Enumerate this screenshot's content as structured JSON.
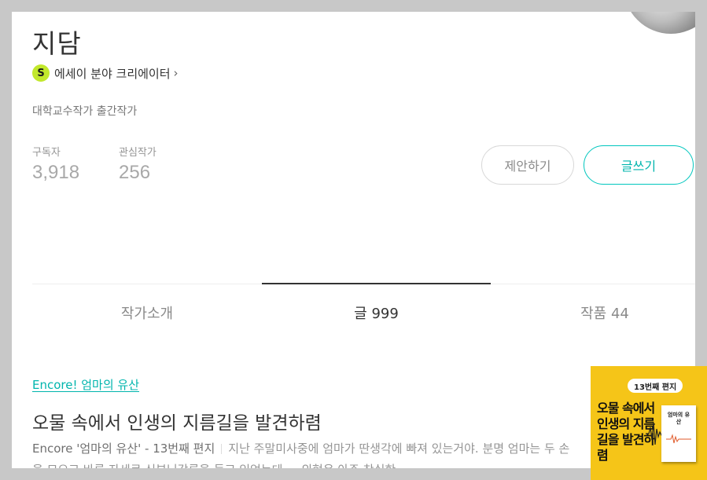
{
  "author": {
    "name": "지담",
    "creator_badge": "S",
    "creator_label": "에세이 분야 크리에이터",
    "creator_chevron": "›",
    "bio": "대학교수작가 출간작가"
  },
  "stats": {
    "subscribers_label": "구독자",
    "subscribers_value": "3,918",
    "following_label": "관심작가",
    "following_value": "256"
  },
  "actions": {
    "propose_label": "제안하기",
    "write_label": "글쓰기"
  },
  "tabs": [
    {
      "label": "작가소개",
      "active": false
    },
    {
      "label": "글 999",
      "active": true
    },
    {
      "label": "작품 44",
      "active": false
    }
  ],
  "post": {
    "series": "Encore! 엄마의 유산",
    "title": "오물 속에서 인생의 지름길을 발견하렴",
    "subtitle": "Encore '엄마의 유산' - 13번째 편지",
    "excerpt": "지난 주말미사중에 엄마가 딴생각에 빠져 있는거야. 분명 엄마는 두 손을 모으고 바른 자세로 신부님강론을 듣고 있었는데.... 외형은 아주 착실한 …",
    "thumbnail": {
      "badge": "13번째 편지",
      "title": "오물 속에서 인생의 지름길을 발견하렴",
      "book_title": "엄마의 유산"
    }
  },
  "colors": {
    "accent": "#00b5ad",
    "creator_badge": "#c2e82c",
    "thumbnail_bg": "#f5c518"
  },
  "icons": {
    "creator": "s-badge-icon",
    "chevron": "chevron-right-icon",
    "more": "more-vertical-icon",
    "avatar": "profile-photo"
  }
}
